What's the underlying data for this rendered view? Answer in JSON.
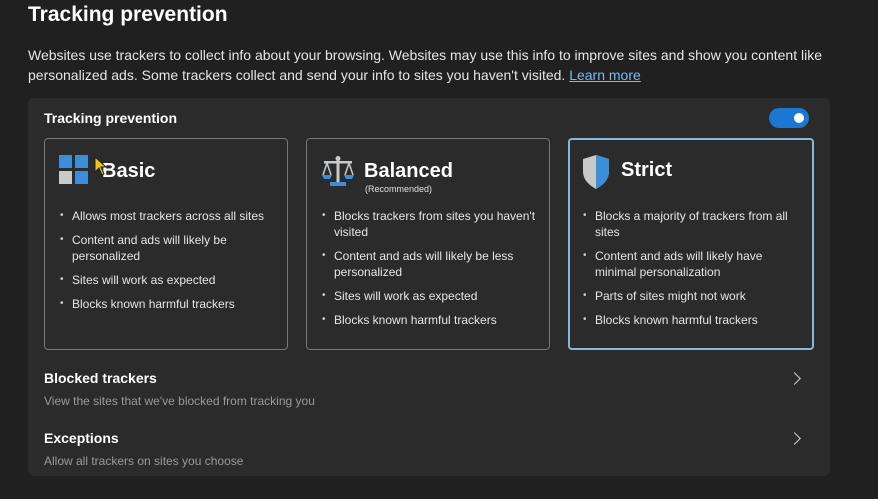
{
  "page": {
    "title": "Tracking prevention",
    "description": "Websites use trackers to collect info about your browsing. Websites may use this info to improve sites and show you content like personalized ads. Some trackers collect and send your info to sites you haven't visited.",
    "learn_more": "Learn more"
  },
  "panel": {
    "heading": "Tracking prevention",
    "toggle_on": true,
    "toggle_color": "#1a78d2",
    "selected_level": "Strict",
    "cards": {
      "basic": {
        "title": "Basic",
        "icon": "basic-grid-icon",
        "items": [
          "Allows most trackers across all sites",
          "Content and ads will likely be personalized",
          "Sites will work as expected",
          "Blocks known harmful trackers"
        ]
      },
      "balanced": {
        "title": "Balanced",
        "subtitle": "(Recommended)",
        "icon": "scales-icon",
        "items": [
          "Blocks trackers from sites you haven't visited",
          "Content and ads will likely be less personalized",
          "Sites will work as expected",
          "Blocks known harmful trackers"
        ]
      },
      "strict": {
        "title": "Strict",
        "icon": "shield-icon",
        "items": [
          "Blocks a majority of trackers from all sites",
          "Content and ads will likely have minimal personalization",
          "Parts of sites might not work",
          "Blocks known harmful trackers"
        ]
      }
    }
  },
  "rows": {
    "blocked": {
      "title": "Blocked trackers",
      "subtitle": "View the sites that we've blocked from tracking you"
    },
    "exceptions": {
      "title": "Exceptions",
      "subtitle": "Allow all trackers on sites you choose"
    }
  },
  "colors": {
    "accent": "#1a78d2",
    "selected_border": "#8ab8dc",
    "link": "#7bb9f0"
  }
}
